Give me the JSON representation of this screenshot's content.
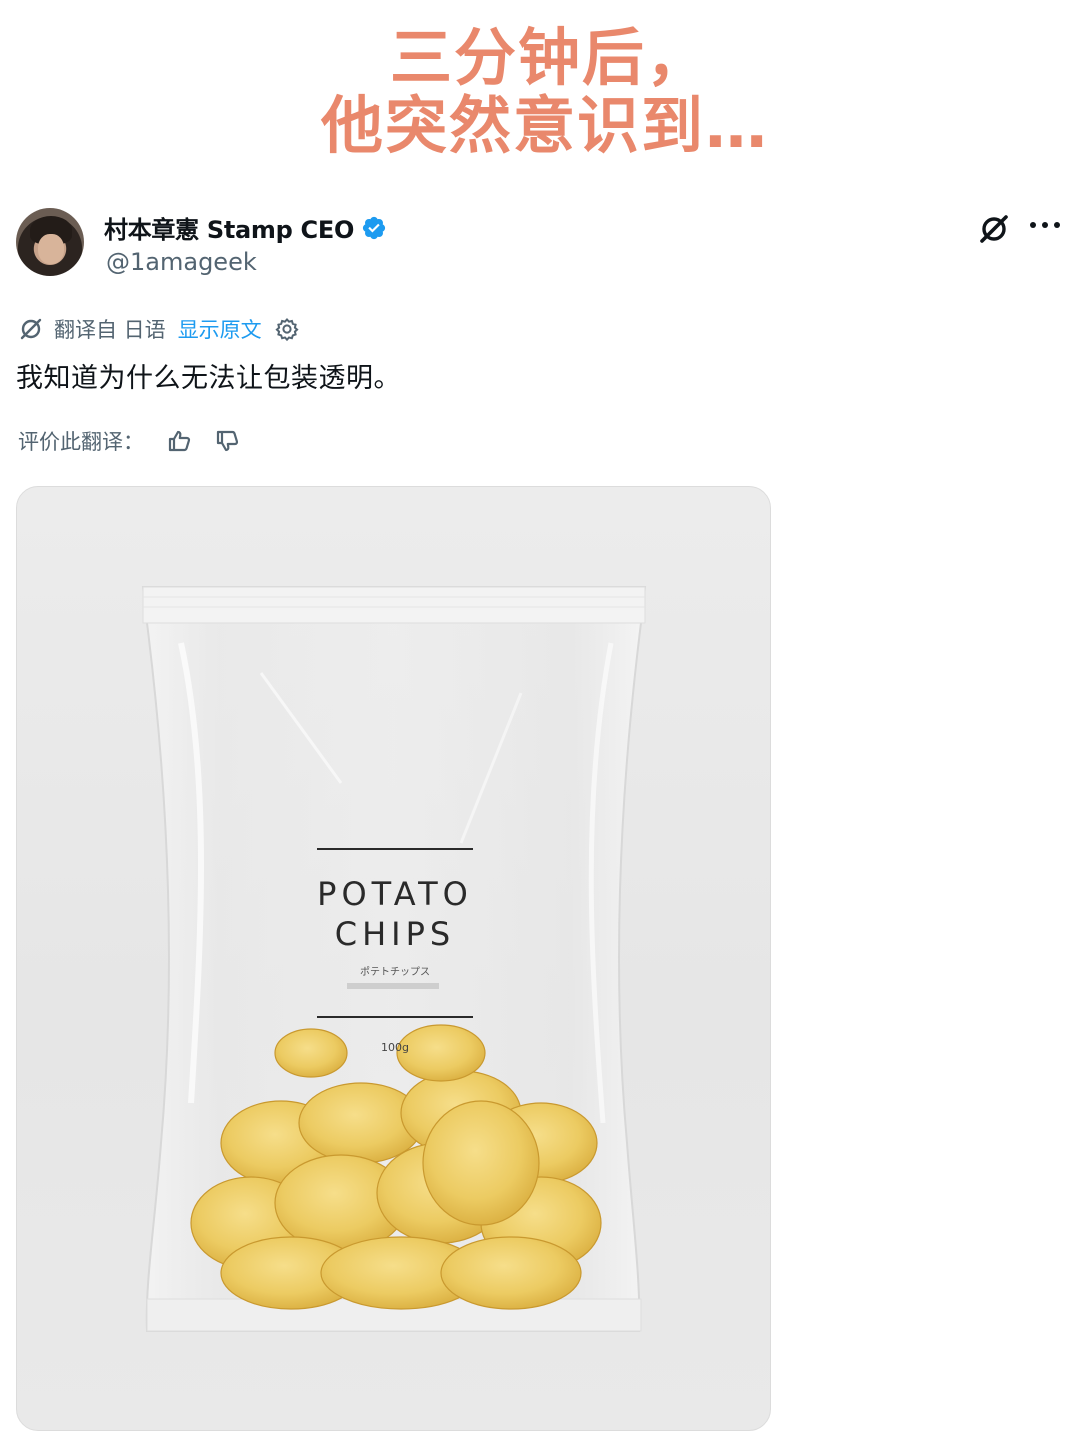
{
  "caption": {
    "line1": "三分钟后，",
    "line2": "他突然意识到…"
  },
  "tweet": {
    "author_name": "村本章憲 Stamp CEO",
    "handle": "@1amageek",
    "translation": {
      "translated_from": "翻译自 日语",
      "show_original": "显示原文"
    },
    "text": "我知道为什么无法让包装透明。",
    "rate_translation_label": "评价此翻译："
  },
  "media": {
    "product_title_line1": "POTATO",
    "product_title_line2": "CHIPS",
    "product_subtitle": "ポテトチップス",
    "product_weight": "100g"
  },
  "colors": {
    "caption": "#e9886c",
    "link_blue": "#1d9bf0",
    "verified_blue": "#1d9bf0",
    "secondary_text": "#536471",
    "primary_text": "#0f1419"
  },
  "icons": {
    "verified": "verified-badge-icon",
    "grok": "grok-icon",
    "more": "more-icon",
    "translate": "translate-icon",
    "settings": "gear-icon",
    "thumbs_up": "thumbs-up-icon",
    "thumbs_down": "thumbs-down-icon"
  }
}
